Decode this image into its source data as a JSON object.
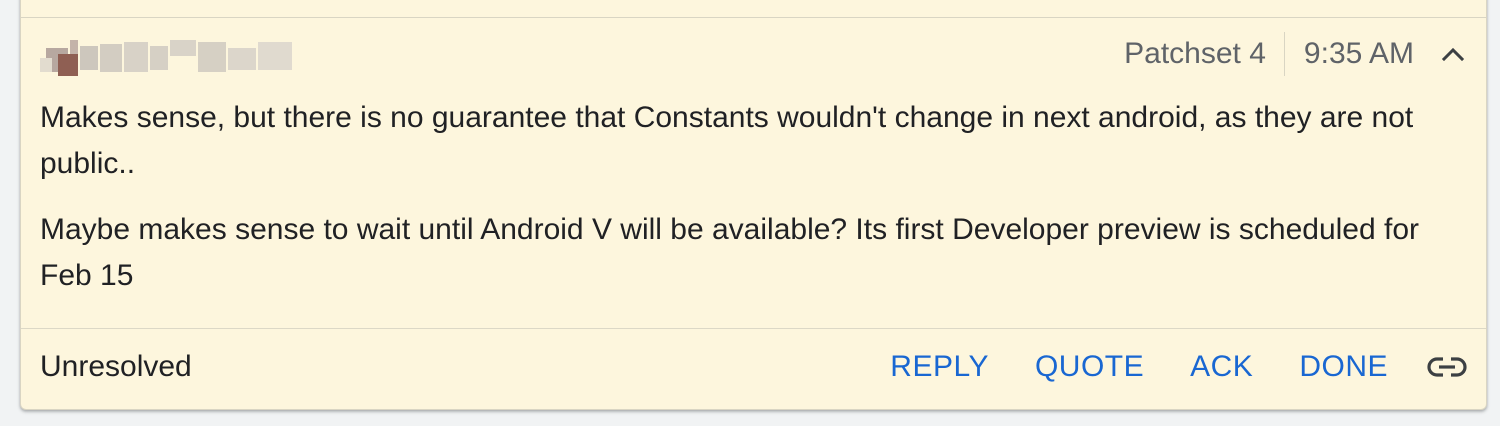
{
  "comment": {
    "author_name_blurred": true,
    "patchset": "Patchset 4",
    "time": "9:35 AM",
    "collapse_icon": "chevron-up-icon",
    "paragraphs": [
      "Makes sense, but there is no guarantee that Constants wouldn't change in next android, as they are not public..",
      "Maybe makes sense to wait until Android V will be available? Its first Developer preview is scheduled for Feb 15"
    ],
    "status": "Unresolved",
    "actions": {
      "reply": "REPLY",
      "quote": "QUOTE",
      "ack": "ACK",
      "done": "DONE"
    },
    "link_icon": "link-icon"
  },
  "colors": {
    "card_background": "#fdf6dd",
    "action_text": "#1967d2",
    "meta_text": "#5f6368",
    "body_text": "#202124"
  }
}
